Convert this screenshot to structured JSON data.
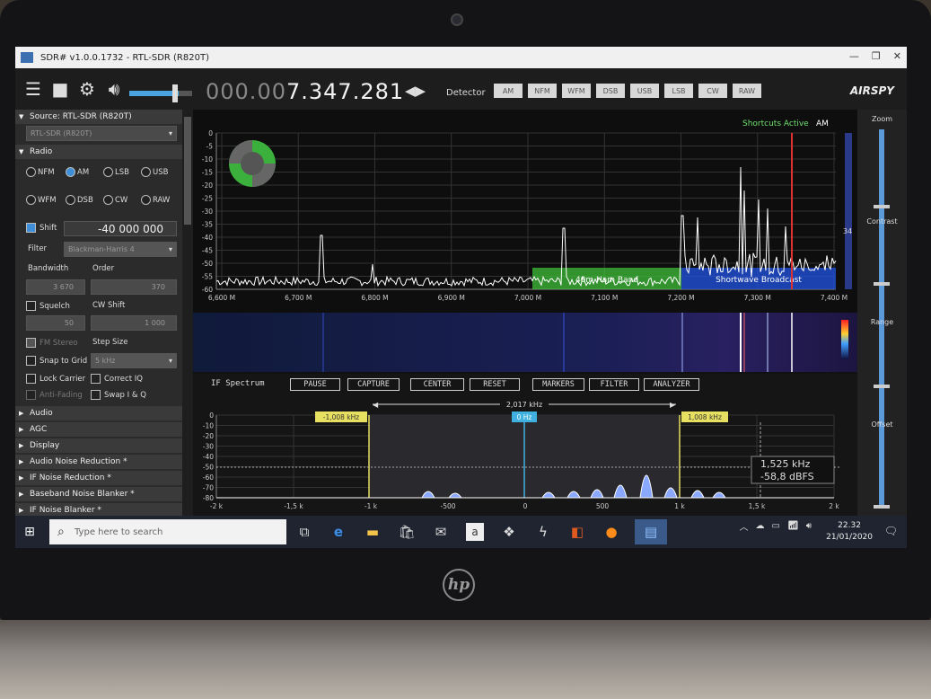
{
  "window": {
    "title": "SDR# v1.0.0.1732 - RTL-SDR (R820T)"
  },
  "toolbar": {
    "freq_dim": "000.00",
    "freq_bright": "7.347.281",
    "detector_label": "Detector",
    "modes": [
      "AM",
      "NFM",
      "WFM",
      "DSB",
      "USB",
      "LSB",
      "CW",
      "RAW"
    ],
    "brand": "AIRSPY"
  },
  "sidebar": {
    "source_header": "Source: RTL-SDR (R820T)",
    "source_value": "RTL-SDR (R820T)",
    "radio_header": "Radio",
    "radio_modes_row1": [
      "NFM",
      "AM",
      "LSB",
      "USB"
    ],
    "radio_modes_row2": [
      "WFM",
      "DSB",
      "CW",
      "RAW"
    ],
    "selected_mode": "AM",
    "shift_label": "Shift",
    "shift_value": "-40 000 000",
    "filter_label": "Filter",
    "filter_value": "Blackman-Harris 4",
    "bandwidth_label": "Bandwidth",
    "order_label": "Order",
    "bandwidth_value": "3 670",
    "order_value": "370",
    "squelch_label": "Squelch",
    "cwshift_label": "CW Shift",
    "squelch_value": "50",
    "cwshift_value": "1 000",
    "fmstereo_label": "FM Stereo",
    "stepsize_label": "Step Size",
    "snap_label": "Snap to Grid",
    "snap_value": "5 kHz",
    "lockcarrier_label": "Lock Carrier",
    "correctiq_label": "Correct IQ",
    "antifading_label": "Anti-Fading",
    "swapiq_label": "Swap I & Q",
    "sections": [
      "Audio",
      "AGC",
      "Display",
      "Audio Noise Reduction *",
      "IF Noise Reduction *",
      "Baseband Noise Blanker *",
      "IF Noise Blanker *"
    ]
  },
  "spectrum": {
    "shortcuts_label": "Shortcuts Active",
    "shortcuts_mode": "AM",
    "y_ticks": [
      "0",
      "-5",
      "-10",
      "-15",
      "-20",
      "-25",
      "-30",
      "-35",
      "-40",
      "-45",
      "-50",
      "-55",
      "-60"
    ],
    "x_ticks": [
      "6,600 M",
      "6,700 M",
      "6,800 M",
      "6,900 M",
      "7,000 M",
      "7,100 M",
      "7,200 M",
      "7,300 M",
      "7,400 M"
    ],
    "band_ham": "40m Ham Band",
    "band_broadcast": "Shortwave Broadcast",
    "side_value": "34",
    "colors": {
      "ham": "#3fbf3a",
      "broadcast": "#2050d8",
      "trace": "#ffffff",
      "marker": "#e03030"
    }
  },
  "if_spectrum": {
    "title": "IF Spectrum",
    "buttons": [
      "PAUSE",
      "CAPTURE",
      "CENTER",
      "RESET",
      "MARKERS",
      "FILTER",
      "ANALYZER"
    ],
    "width_label": "2,017 kHz",
    "left_marker": "-1,008 kHz",
    "center_marker": "0 Hz",
    "right_marker": "1,008 kHz",
    "y_ticks": [
      "0",
      "-10",
      "-20",
      "-30",
      "-40",
      "-50",
      "-60",
      "-70",
      "-80"
    ],
    "x_ticks": [
      "-2 k",
      "-1,5 k",
      "-1 k",
      "-500",
      "0",
      "500",
      "1 k",
      "1,5 k",
      "2 k"
    ],
    "readout_freq": "1,525 kHz",
    "readout_level": "-58,8 dBFS"
  },
  "rail": {
    "zoom": "Zoom",
    "contrast": "Contrast",
    "range": "Range",
    "offset": "Offset"
  },
  "taskbar": {
    "search_placeholder": "Type here to search",
    "time": "22.32",
    "date": "21/01/2020"
  },
  "laptop": {
    "logo": "hp"
  }
}
